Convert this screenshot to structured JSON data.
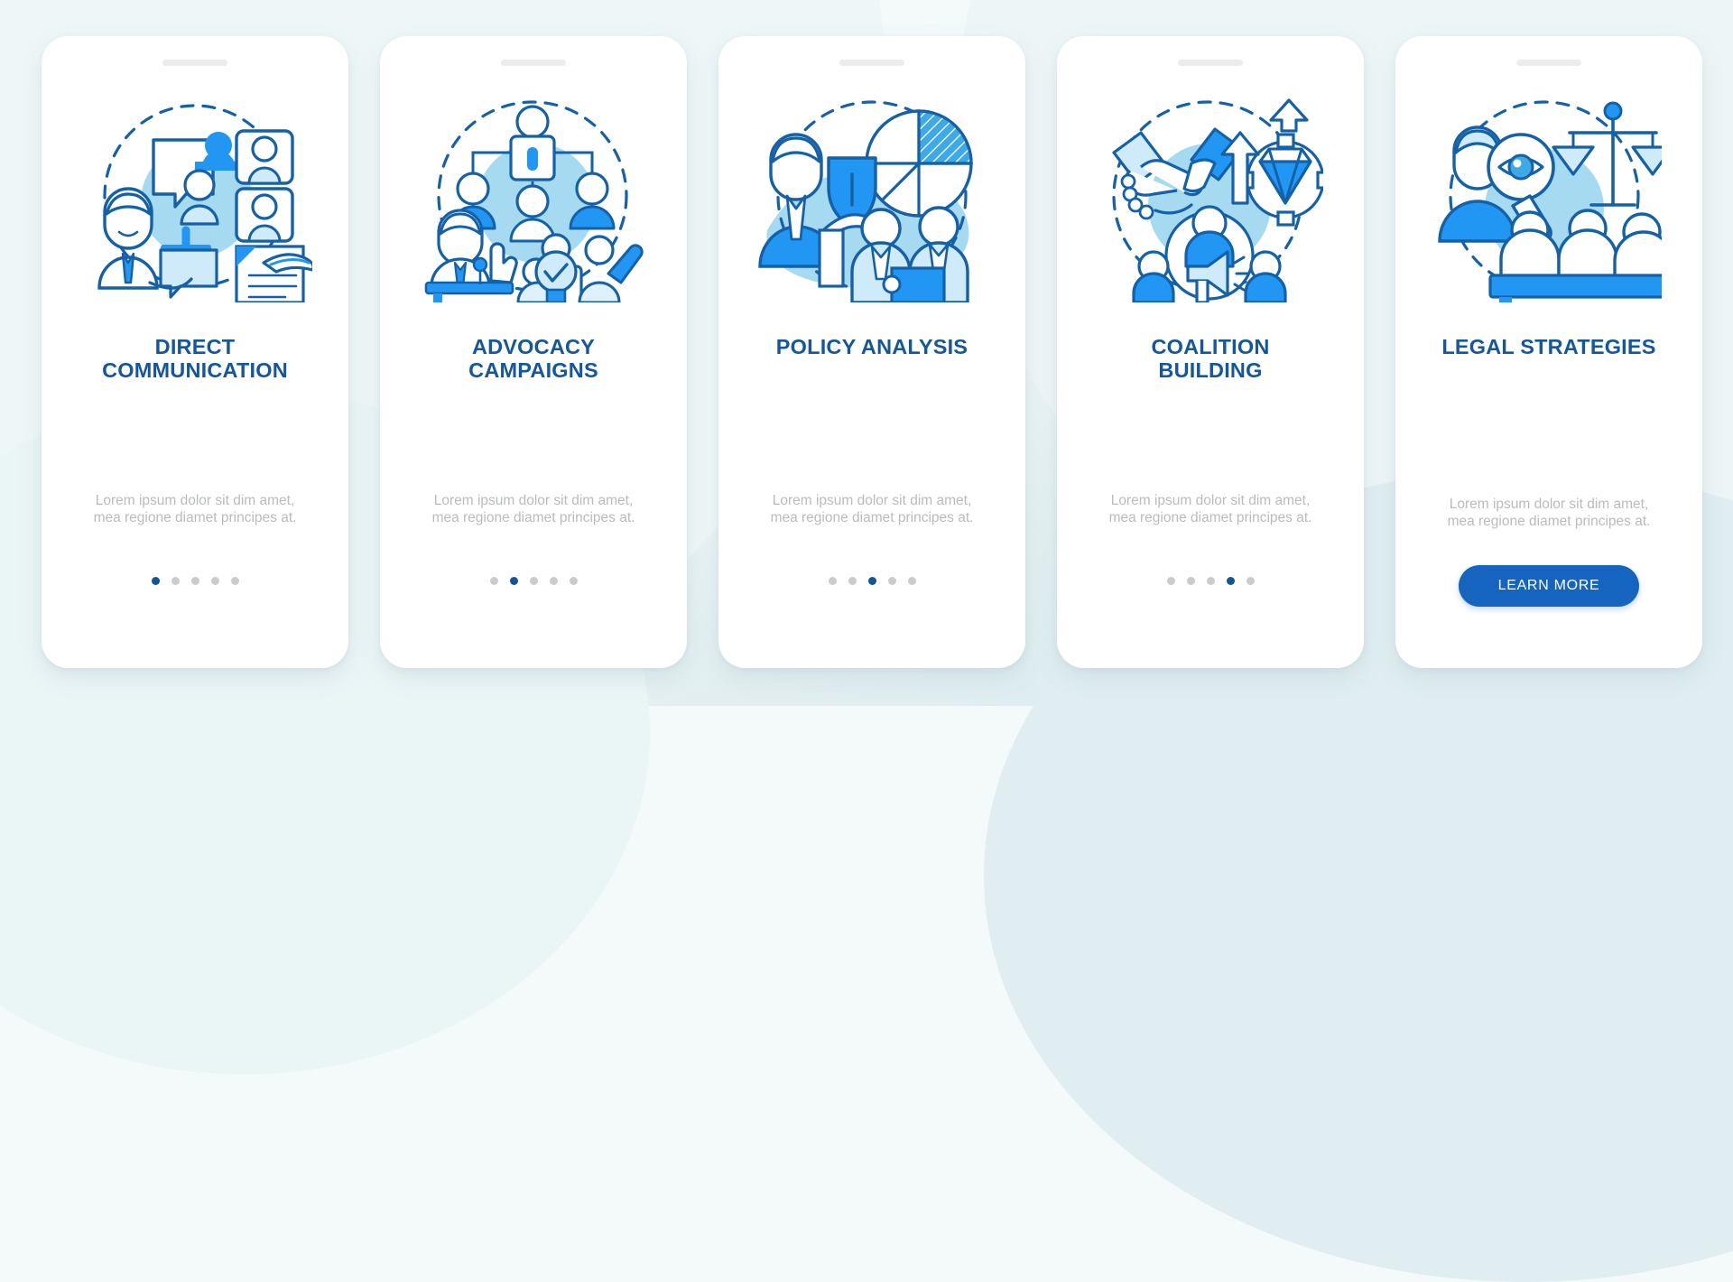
{
  "background": {
    "base_color": "#f2f9fa",
    "accent_color": "#d6e9ed"
  },
  "palette": {
    "title_blue": "#14579e",
    "dot_active": "#12549a",
    "dot_inactive": "#c9cccd",
    "body_gray": "#b9bcbd",
    "button_blue": "#1565c0",
    "illustration_dark": "#1461a8",
    "illustration_mid": "#2196f3",
    "illustration_light": "#a8dcf0",
    "illustration_pale": "#d5eefb"
  },
  "cards": [
    {
      "id": "direct-communication",
      "title": "DIRECT COMMUNICATION",
      "title_lines": [
        "DIRECT",
        "COMMUNICATION"
      ],
      "body": "Lorem ipsum dolor sit dim amet, mea regione diamet principes at.",
      "illustration_name": "direct-communication-illustration",
      "dots": {
        "count": 5,
        "active_index": 0
      },
      "has_button": false
    },
    {
      "id": "advocacy-campaigns",
      "title": "ADVOCACY CAMPAIGNS",
      "title_lines": [
        "ADVOCACY",
        "CAMPAIGNS"
      ],
      "body": "Lorem ipsum dolor sit dim amet, mea regione diamet principes at.",
      "illustration_name": "advocacy-campaigns-illustration",
      "dots": {
        "count": 5,
        "active_index": 1
      },
      "has_button": false
    },
    {
      "id": "policy-analysis",
      "title": "POLICY ANALYSIS",
      "title_lines": [
        "POLICY ANALYSIS"
      ],
      "body": "Lorem ipsum dolor sit dim amet, mea regione diamet principes at.",
      "illustration_name": "policy-analysis-illustration",
      "dots": {
        "count": 5,
        "active_index": 2
      },
      "has_button": false
    },
    {
      "id": "coalition-building",
      "title": "COALITION BUILDING",
      "title_lines": [
        "COALITION",
        "BUILDING"
      ],
      "body": "Lorem ipsum dolor sit dim amet, mea regione diamet principes at.",
      "illustration_name": "coalition-building-illustration",
      "dots": {
        "count": 5,
        "active_index": 3
      },
      "has_button": false
    },
    {
      "id": "legal-strategies",
      "title": "LEGAL STRATEGIES",
      "title_lines": [
        "LEGAL STRATEGIES"
      ],
      "body": "Lorem ipsum dolor sit dim amet, mea regione diamet principes at.",
      "illustration_name": "legal-strategies-illustration",
      "dots": {
        "count": 0,
        "active_index": -1
      },
      "has_button": true,
      "button_label": "LEARN MORE"
    }
  ]
}
